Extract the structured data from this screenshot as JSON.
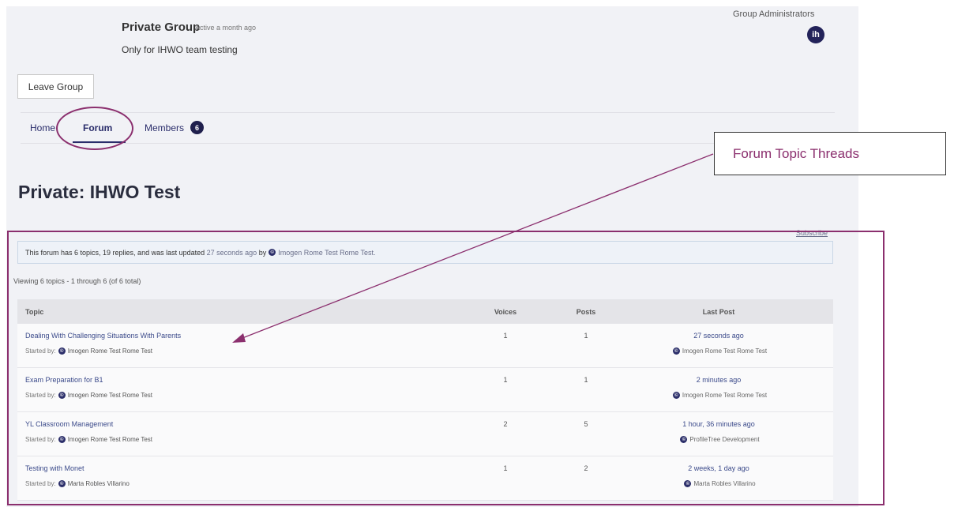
{
  "group": {
    "title": "Private Group",
    "activity": "Active a month ago",
    "description": "Only for IHWO team testing",
    "admins_label": "Group Administrators",
    "admin_avatar_text": "ih",
    "leave_button": "Leave Group"
  },
  "nav": {
    "tabs": [
      {
        "label": "Home"
      },
      {
        "label": "Forum",
        "active": true
      },
      {
        "label": "Members",
        "badge": "6"
      }
    ]
  },
  "page_title": "Private: IHWO Test",
  "subscribe": "Subscribe",
  "forum_info": {
    "lead": "This forum has 6 topics, 19 replies, and was last updated",
    "updated": "27 seconds ago",
    "by": "by",
    "author": "Imogen Rome Test Rome Test."
  },
  "viewing": "Viewing 6 topics - 1 through 6 (of 6 total)",
  "table": {
    "headers": {
      "topic": "Topic",
      "voices": "Voices",
      "posts": "Posts",
      "last_post": "Last Post"
    },
    "started_by_label": "Started by:",
    "rows": [
      {
        "title": "Dealing With Challenging Situations With Parents",
        "starter": "Imogen Rome Test Rome Test",
        "voices": "1",
        "posts": "1",
        "freshness": "27 seconds ago",
        "last_author": "Imogen Rome Test Rome Test"
      },
      {
        "title": "Exam Preparation for B1",
        "starter": "Imogen Rome Test Rome Test",
        "voices": "1",
        "posts": "1",
        "freshness": "2 minutes ago",
        "last_author": "Imogen Rome Test Rome Test"
      },
      {
        "title": "YL Classroom Management",
        "starter": "Imogen Rome Test Rome Test",
        "voices": "2",
        "posts": "5",
        "freshness": "1 hour, 36 minutes ago",
        "last_author": "ProfileTree Development"
      },
      {
        "title": "Testing with Monet",
        "starter": "Marta Robles Villarino",
        "voices": "1",
        "posts": "2",
        "freshness": "2 weeks, 1 day ago",
        "last_author": "Marta Robles Villarino"
      }
    ]
  },
  "annotation": {
    "label": "Forum Topic Threads",
    "color": "#8b2f6e"
  }
}
